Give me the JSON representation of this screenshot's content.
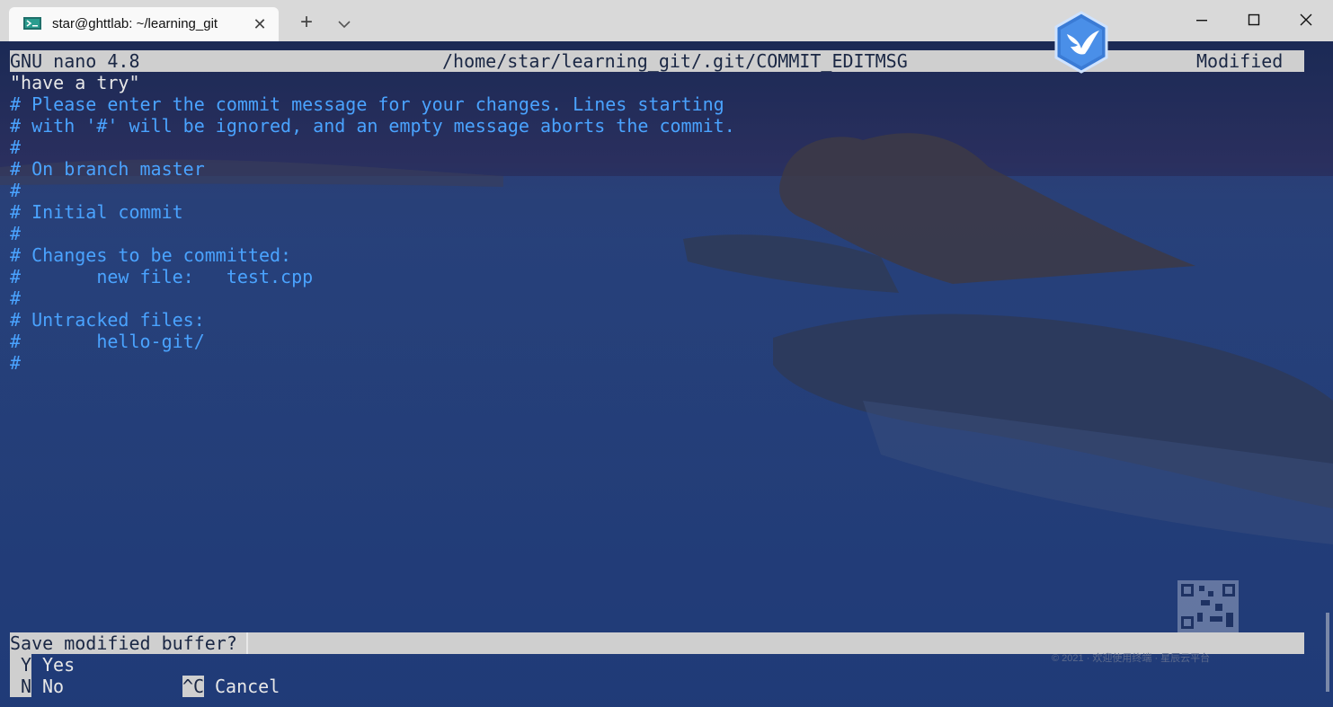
{
  "window": {
    "tab_title": "star@ghttlab: ~/learning_git",
    "tab_close": "✕",
    "new_tab": "+"
  },
  "nano": {
    "header": {
      "app": "GNU nano 4.8",
      "file": "/home/star/learning_git/.git/COMMIT_EDITMSG",
      "status": "Modified"
    },
    "lines": [
      "\"have a try\"",
      "# Please enter the commit message for your changes. Lines starting",
      "# with '#' will be ignored, and an empty message aborts the commit.",
      "#",
      "# On branch master",
      "#",
      "# Initial commit",
      "#",
      "# Changes to be committed:",
      "#       new file:   test.cpp",
      "#",
      "# Untracked files:",
      "#       hello-git/",
      "#"
    ],
    "prompt": "Save modified buffer?",
    "options": {
      "yes_key": "Y",
      "yes_label": "Yes",
      "no_key": "N",
      "no_label": "No",
      "cancel_key": "^C",
      "cancel_label": "Cancel"
    }
  },
  "watermark": "© 2021 · 欢迎使用终端 · 星辰云平台",
  "colors": {
    "terminal_bg": "#1c2b52",
    "comment_text": "#4aa3ff",
    "normal_text": "#e8e8e8",
    "inverse_bar": "#cfcfcf"
  }
}
